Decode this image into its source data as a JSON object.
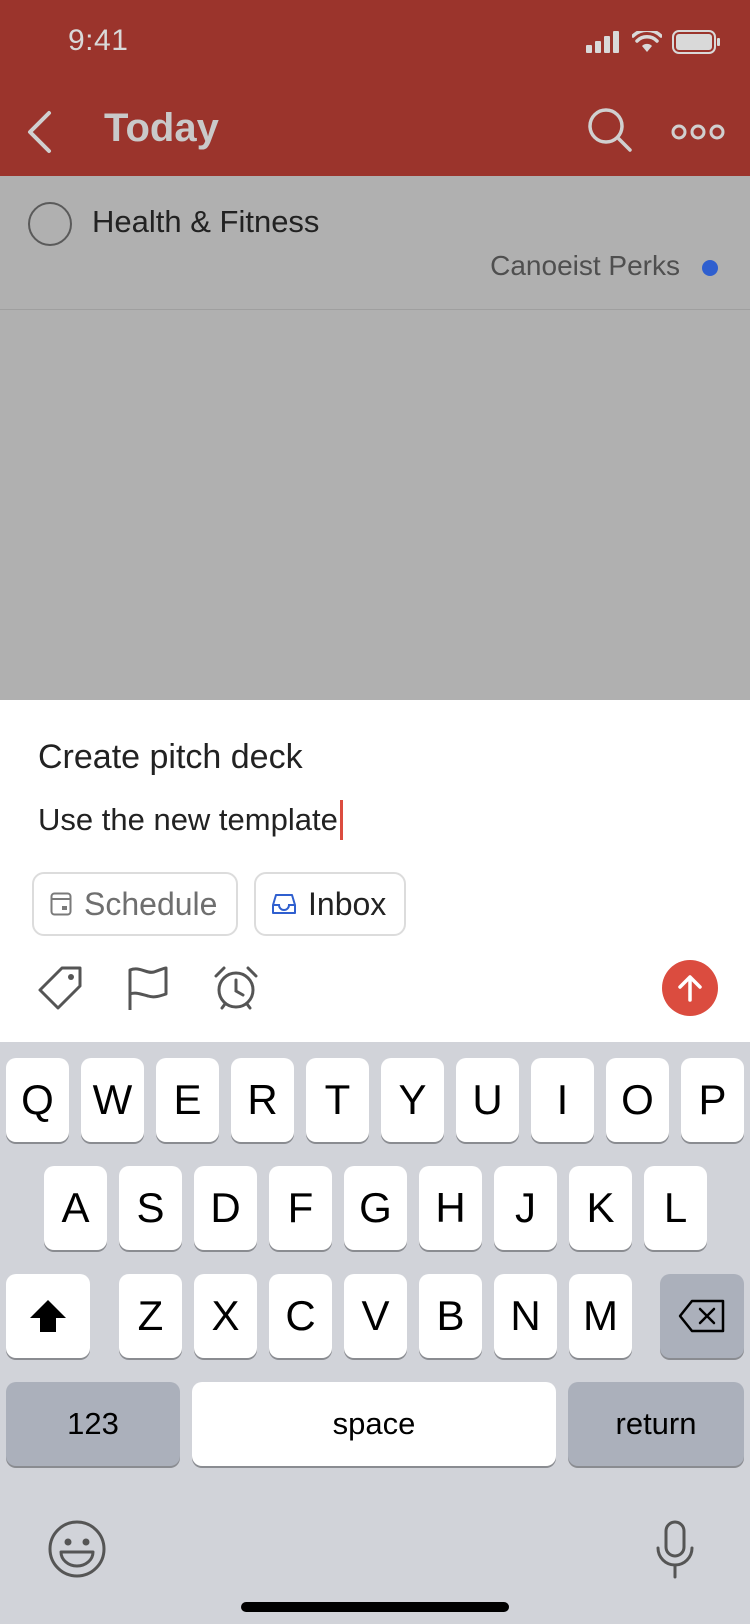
{
  "status_bar": {
    "time": "9:41"
  },
  "header": {
    "title": "Today"
  },
  "task": {
    "title": "Health & Fitness",
    "project": "Canoeist Perks"
  },
  "quick_add": {
    "name": "Create pitch deck",
    "description": "Use the new template",
    "schedule_label": "Schedule",
    "project_label": "Inbox"
  },
  "keyboard": {
    "row1": [
      "Q",
      "W",
      "E",
      "R",
      "T",
      "Y",
      "U",
      "I",
      "O",
      "P"
    ],
    "row2": [
      "A",
      "S",
      "D",
      "F",
      "G",
      "H",
      "J",
      "K",
      "L"
    ],
    "row3": [
      "Z",
      "X",
      "C",
      "V",
      "B",
      "N",
      "M"
    ],
    "numbers": "123",
    "space": "space",
    "return": "return"
  },
  "colors": {
    "header": "#9b342c",
    "accent": "#db4c3f",
    "project_dot": "#2f5fcf"
  }
}
